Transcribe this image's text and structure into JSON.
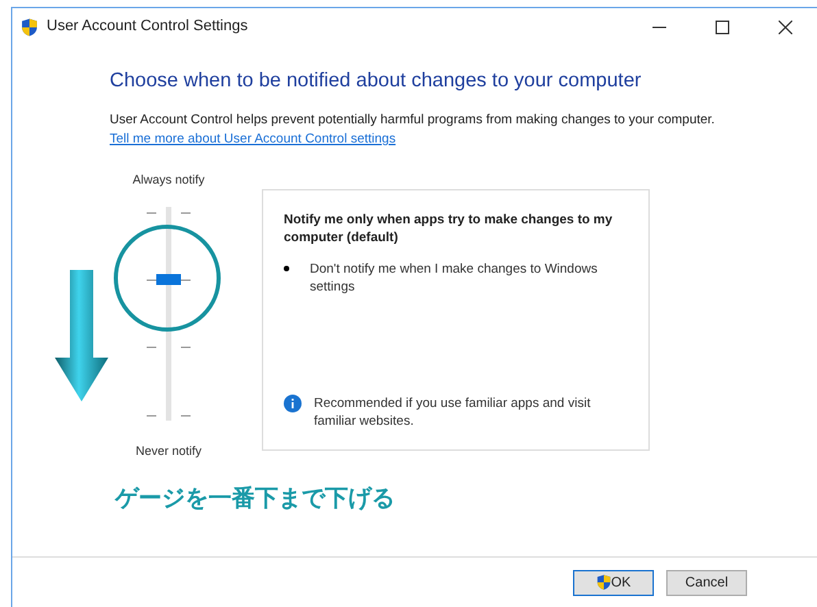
{
  "window": {
    "title": "User Account Control Settings"
  },
  "heading": "Choose when to be notified about changes to your computer",
  "description": "User Account Control helps prevent potentially harmful programs from making changes to your computer.",
  "link": "Tell me more about User Account Control settings",
  "slider": {
    "top_label": "Always notify",
    "bottom_label": "Never notify",
    "level": 0.667
  },
  "info_panel": {
    "title": "Notify me only when apps try to make changes to my computer (default)",
    "bullets": [
      "Don't notify me when I make changes to Windows settings"
    ],
    "note": "Recommended if you use familiar apps and visit familiar websites."
  },
  "annotation": {
    "caption": "ゲージを一番下まで下げる"
  },
  "buttons": [
    {
      "label": "OK",
      "kind": "shield",
      "focused": true
    },
    {
      "label": "Cancel",
      "kind": "plain",
      "focused": false
    }
  ]
}
